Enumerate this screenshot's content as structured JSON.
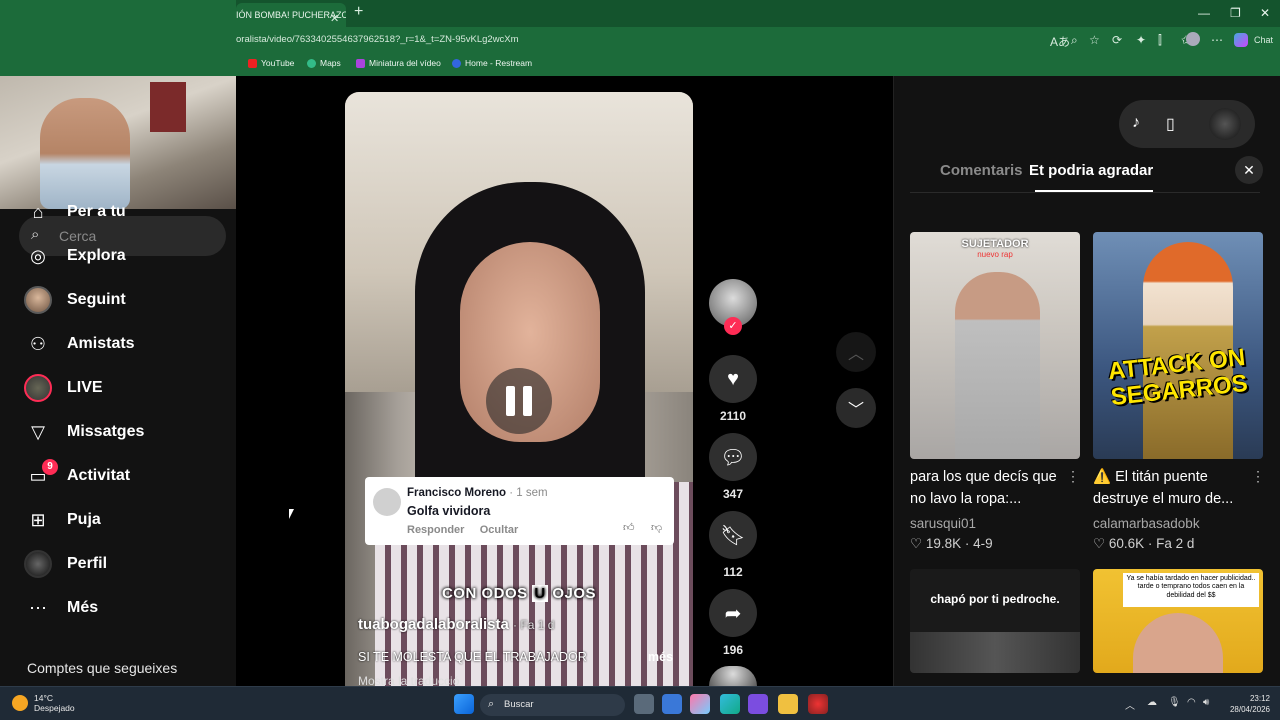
{
  "browser": {
    "tab_title": "IÓN BOMBA! PUCHERAZO",
    "url": "oralista/video/7633402554637962518?_r=1&_t=ZN-95vKLg2wcXm",
    "chat_label": "Chat",
    "bookmarks": [
      "YouTube",
      "Maps",
      "Miniatura del vídeo",
      "Home - Restream"
    ]
  },
  "sidebar": {
    "search_placeholder": "Cerca",
    "items": [
      {
        "label": "Per a tu",
        "icon": "home-icon"
      },
      {
        "label": "Explora",
        "icon": "compass-icon"
      },
      {
        "label": "Seguint",
        "icon": "avatar-icon"
      },
      {
        "label": "Amistats",
        "icon": "friends-icon"
      },
      {
        "label": "LIVE",
        "icon": "live-icon"
      },
      {
        "label": "Missatges",
        "icon": "send-icon"
      },
      {
        "label": "Activitat",
        "icon": "inbox-icon",
        "badge": "9"
      },
      {
        "label": "Puja",
        "icon": "upload-icon"
      },
      {
        "label": "Perfil",
        "icon": "profile-avatar-icon"
      },
      {
        "label": "Més",
        "icon": "more-icon"
      }
    ],
    "following_title": "Comptes que segueixes"
  },
  "video": {
    "comment": {
      "author": "Francisco Moreno",
      "time": "· 1 sem",
      "text": "Golfa vividora",
      "reply": "Responder",
      "hide": "Ocultar"
    },
    "caption_parts": [
      "CON O",
      "DOS ",
      "U",
      " OJOS"
    ],
    "author": "tuabogadalaboralista",
    "posted": "· Fa 1 d",
    "description": "SI TE MOLESTA QUE EL TRABAJADOR",
    "more": "més",
    "translation": "Mostra la traducció"
  },
  "actions": {
    "likes": "2110",
    "comments": "347",
    "saves": "112",
    "shares": "196"
  },
  "panel": {
    "tab_comments": "Comentaris",
    "tab_suggested": "Et podria agradar",
    "recommendations": [
      {
        "title": "para los que decís que no lavo la ropa:...",
        "user": "sarusqui01",
        "likes": "19.8K",
        "date": "4-9",
        "overlay": "SUJETADOR",
        "overlay_sub": "nuevo rap"
      },
      {
        "title": "⚠️ El titán puente destruye el muro de...",
        "user": "calamarbasadobk",
        "likes": "60.6K",
        "date": "Fa 2 d",
        "overlay": "ATTACK ON SEGARROS"
      },
      {
        "overlay": "chapó por ti pedroche."
      },
      {
        "overlay": "Ya se había tardado en hacer publicidad.. tarde o temprano todos caen en la debilidad del $$"
      }
    ]
  },
  "taskbar": {
    "temperature": "14°C",
    "weather": "Despejado",
    "search": "Buscar",
    "time": "23:12",
    "date": "28/04/2026"
  },
  "colors": {
    "accent": "#fe2c55",
    "chrome": "#1c6b3a",
    "background": "#121212"
  }
}
